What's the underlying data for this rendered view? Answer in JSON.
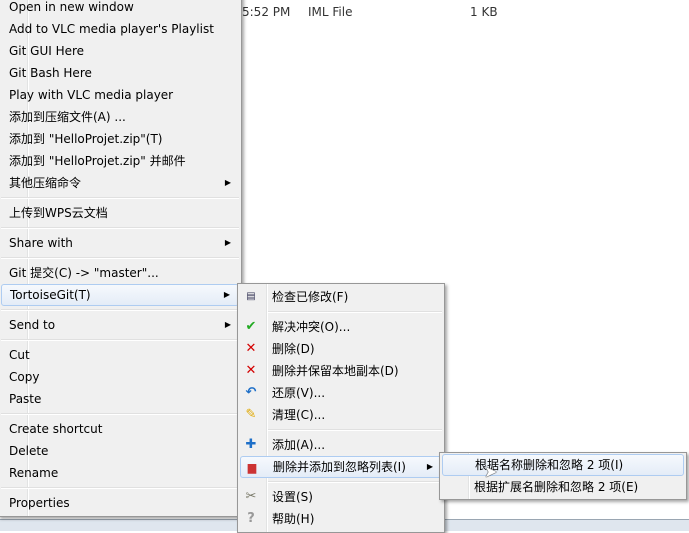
{
  "background": {
    "time": "5:52 PM",
    "type": "IML File",
    "size": "1 KB"
  },
  "main_menu": {
    "items": [
      "Open in new window",
      "Add to VLC media player's Playlist",
      "Git GUI Here",
      "Git Bash Here",
      "Play with VLC media player",
      "添加到压缩文件(A) ...",
      "添加到 \"HelloProjet.zip\"(T)",
      "添加到 \"HelloProjet.zip\" 并邮件",
      "其他压缩命令",
      "上传到WPS云文档",
      "Share with",
      "Git 提交(C) -> \"master\"...",
      "TortoiseGit(T)",
      "Send to",
      "Cut",
      "Copy",
      "Paste",
      "Create shortcut",
      "Delete",
      "Rename",
      "Properties"
    ]
  },
  "tortoise_menu": {
    "items": [
      "检查已修改(F)",
      "解决冲突(O)...",
      "删除(D)",
      "删除并保留本地副本(D)",
      "还原(V)...",
      "清理(C)...",
      "添加(A)...",
      "删除并添加到忽略列表(I)",
      "设置(S)",
      "帮助(H)"
    ]
  },
  "ignore_menu": {
    "items": [
      "根据名称删除和忽略 2 项(I)",
      "根据扩展名删除和忽略 2 项(E)"
    ]
  },
  "colors": {
    "highlight_border": "#aeccf1",
    "delete_red": "#d40000",
    "add_blue": "#1e6fc8"
  }
}
